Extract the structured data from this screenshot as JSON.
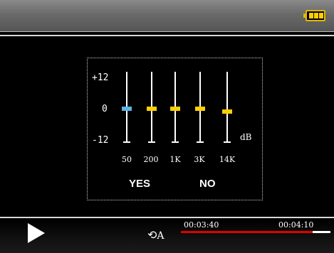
{
  "eq": {
    "scale": {
      "top": "+12",
      "mid": "0",
      "bottom": "-12",
      "unit": "dB"
    },
    "bands": [
      {
        "label": "50",
        "value_db": 0,
        "color": "#5ab4e6"
      },
      {
        "label": "200",
        "value_db": 0,
        "color": "#ffd000"
      },
      {
        "label": "1K",
        "value_db": 0,
        "color": "#ffd000"
      },
      {
        "label": "3K",
        "value_db": 0,
        "color": "#ffd000"
      },
      {
        "label": "14K",
        "value_db": -1,
        "color": "#ffd000"
      }
    ],
    "options": {
      "yes": "YES",
      "no": "NO"
    }
  },
  "player": {
    "repeat_mode": "A",
    "elapsed": "00:03:40",
    "total": "00:04:10",
    "progress": 0.88,
    "colors": {
      "progress": "#e00000",
      "accent": "#ffd000"
    }
  },
  "icons": {
    "battery": "battery-icon",
    "play": "play-icon",
    "repeat": "repeat-icon"
  }
}
